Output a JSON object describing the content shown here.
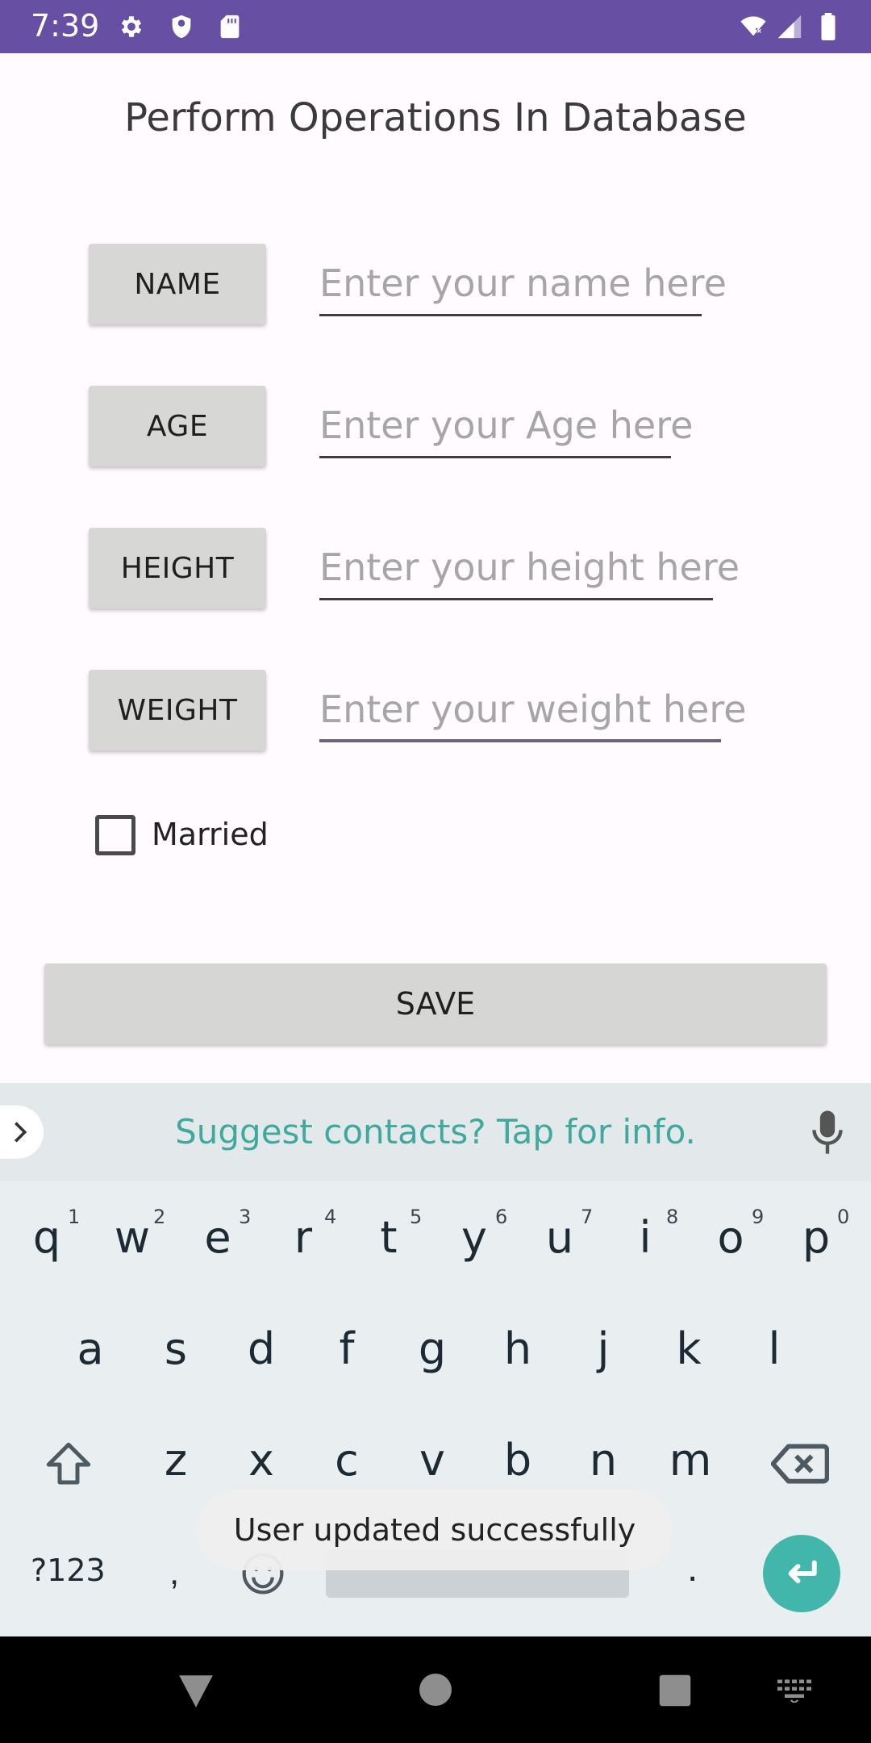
{
  "status_bar": {
    "time": "7:39",
    "icons": [
      "gear-icon",
      "shield-icon",
      "sd-card-icon",
      "wifi-icon",
      "signal-icon",
      "battery-icon"
    ]
  },
  "page": {
    "title": "Perform Operations In Database"
  },
  "form": {
    "rows": [
      {
        "label": "NAME",
        "placeholder": "Enter your name here"
      },
      {
        "label": "AGE",
        "placeholder": "Enter your Age here"
      },
      {
        "label": "HEIGHT",
        "placeholder": "Enter your height here"
      },
      {
        "label": "WEIGHT",
        "placeholder": "Enter your weight here"
      }
    ],
    "checkbox_label": "Married",
    "save_label": "SAVE"
  },
  "keyboard": {
    "suggestion": "Suggest contacts? Tap for info.",
    "row1": [
      "q",
      "w",
      "e",
      "r",
      "t",
      "y",
      "u",
      "i",
      "o",
      "p"
    ],
    "row1_hints": [
      "1",
      "2",
      "3",
      "4",
      "5",
      "6",
      "7",
      "8",
      "9",
      "0"
    ],
    "row2": [
      "a",
      "s",
      "d",
      "f",
      "g",
      "h",
      "j",
      "k",
      "l"
    ],
    "row3": [
      "z",
      "x",
      "c",
      "v",
      "b",
      "n",
      "m"
    ],
    "symbols_label": "?123",
    "comma": ",",
    "period": "."
  },
  "toast": {
    "message": "User updated successfully"
  },
  "colors": {
    "status_bar": "#6750a4",
    "accent": "#43b6ab",
    "suggestion_text": "#40a99f"
  }
}
